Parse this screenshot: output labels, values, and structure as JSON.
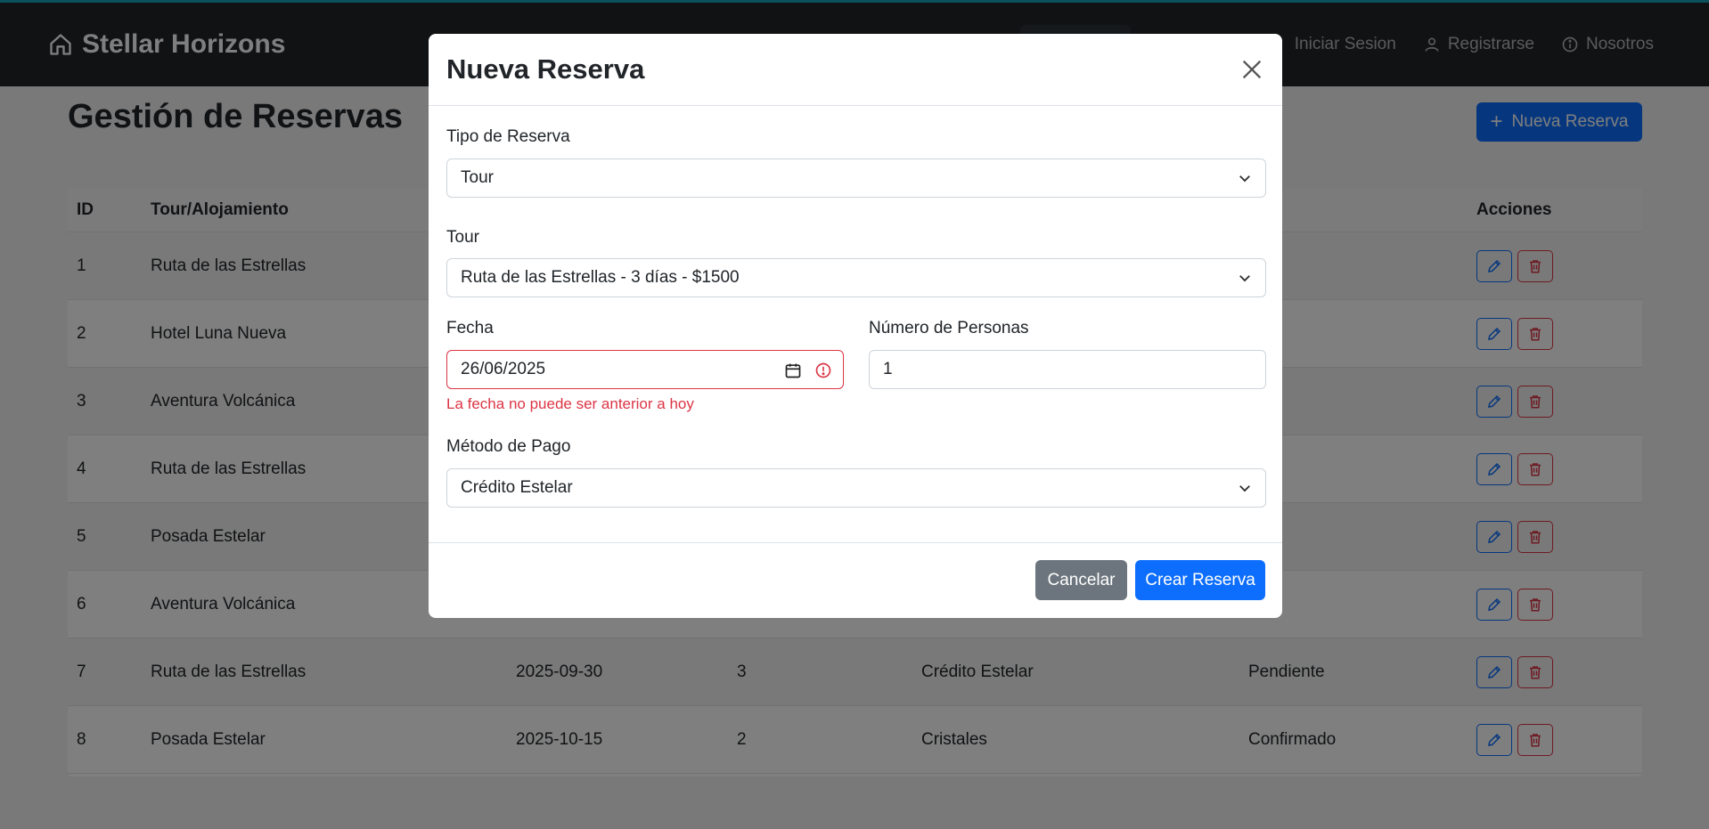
{
  "navbar": {
    "brand": "Stellar Horizons",
    "links": [
      {
        "label": "Iniciar Sesion",
        "icon": "login-icon"
      },
      {
        "label": "Registrarse",
        "icon": "person-icon"
      },
      {
        "label": "Nosotros",
        "icon": "info-icon"
      }
    ]
  },
  "page": {
    "title": "Gestión de Reservas",
    "new_button": "Nueva Reserva"
  },
  "table": {
    "headers": [
      "ID",
      "Tour/Alojamiento",
      "",
      "",
      "",
      "",
      "Acciones"
    ],
    "rows": [
      {
        "id": "1",
        "tour": "Ruta de las Estrellas",
        "fecha": "",
        "personas": "",
        "metodo": "",
        "estado": "ado"
      },
      {
        "id": "2",
        "tour": "Hotel Luna Nueva",
        "fecha": "",
        "personas": "",
        "metodo": "",
        "estado": "te"
      },
      {
        "id": "3",
        "tour": "Aventura Volcánica",
        "fecha": "",
        "personas": "",
        "metodo": "",
        "estado": "ado"
      },
      {
        "id": "4",
        "tour": "Ruta de las Estrellas",
        "fecha": "",
        "personas": "",
        "metodo": "",
        "estado": "do"
      },
      {
        "id": "5",
        "tour": "Posada Estelar",
        "fecha": "",
        "personas": "",
        "metodo": "",
        "estado": "te"
      },
      {
        "id": "6",
        "tour": "Aventura Volcánica",
        "fecha": "",
        "personas": "",
        "metodo": "",
        "estado": "ado"
      },
      {
        "id": "7",
        "tour": "Ruta de las Estrellas",
        "fecha": "2025-09-30",
        "personas": "3",
        "metodo": "Crédito Estelar",
        "estado": "Pendiente"
      },
      {
        "id": "8",
        "tour": "Posada Estelar",
        "fecha": "2025-10-15",
        "personas": "2",
        "metodo": "Cristales",
        "estado": "Confirmado"
      }
    ]
  },
  "modal": {
    "title": "Nueva Reserva",
    "tipo_label": "Tipo de Reserva",
    "tipo_value": "Tour",
    "tour_label": "Tour",
    "tour_value": "Ruta de las Estrellas - 3 días - $1500",
    "fecha_label": "Fecha",
    "fecha_value": "26/06/2025",
    "fecha_error": "La fecha no puede ser anterior a hoy",
    "personas_label": "Número de Personas",
    "personas_value": "1",
    "metodo_label": "Método de Pago",
    "metodo_value": "Crédito Estelar",
    "cancel": "Cancelar",
    "create": "Crear Reserva"
  },
  "colors": {
    "navbar": "#212529",
    "accent": "#0d6efd",
    "danger": "#dc3545",
    "secondary": "#6c757d"
  }
}
